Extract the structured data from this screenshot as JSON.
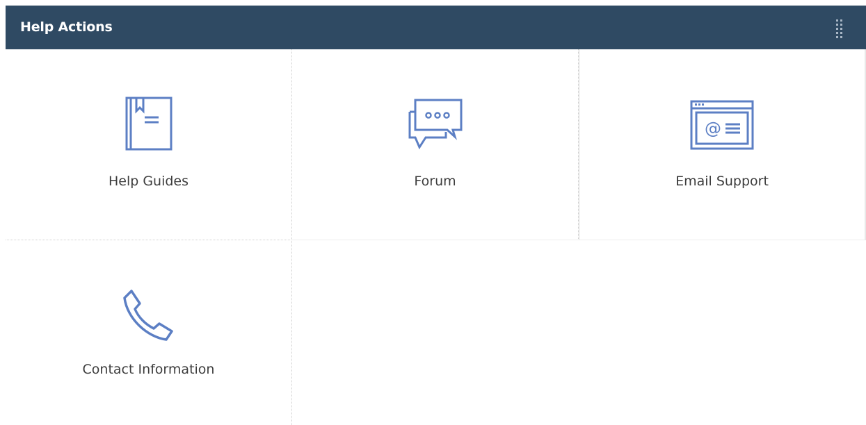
{
  "header": {
    "title": "Help Actions",
    "drag_icon": "grip-dots-icon"
  },
  "tiles": [
    {
      "label": "Help Guides",
      "icon": "book-icon"
    },
    {
      "label": "Forum",
      "icon": "chat-bubbles-icon"
    },
    {
      "label": "Email Support",
      "icon": "email-window-icon"
    },
    {
      "label": "Contact Information",
      "icon": "phone-icon"
    }
  ],
  "colors": {
    "header_bg": "#2f4a63",
    "header_text": "#ffffff",
    "icon_stroke": "#5c7fc4",
    "label_text": "#3d3d3d",
    "divider": "#cfcfcf"
  }
}
